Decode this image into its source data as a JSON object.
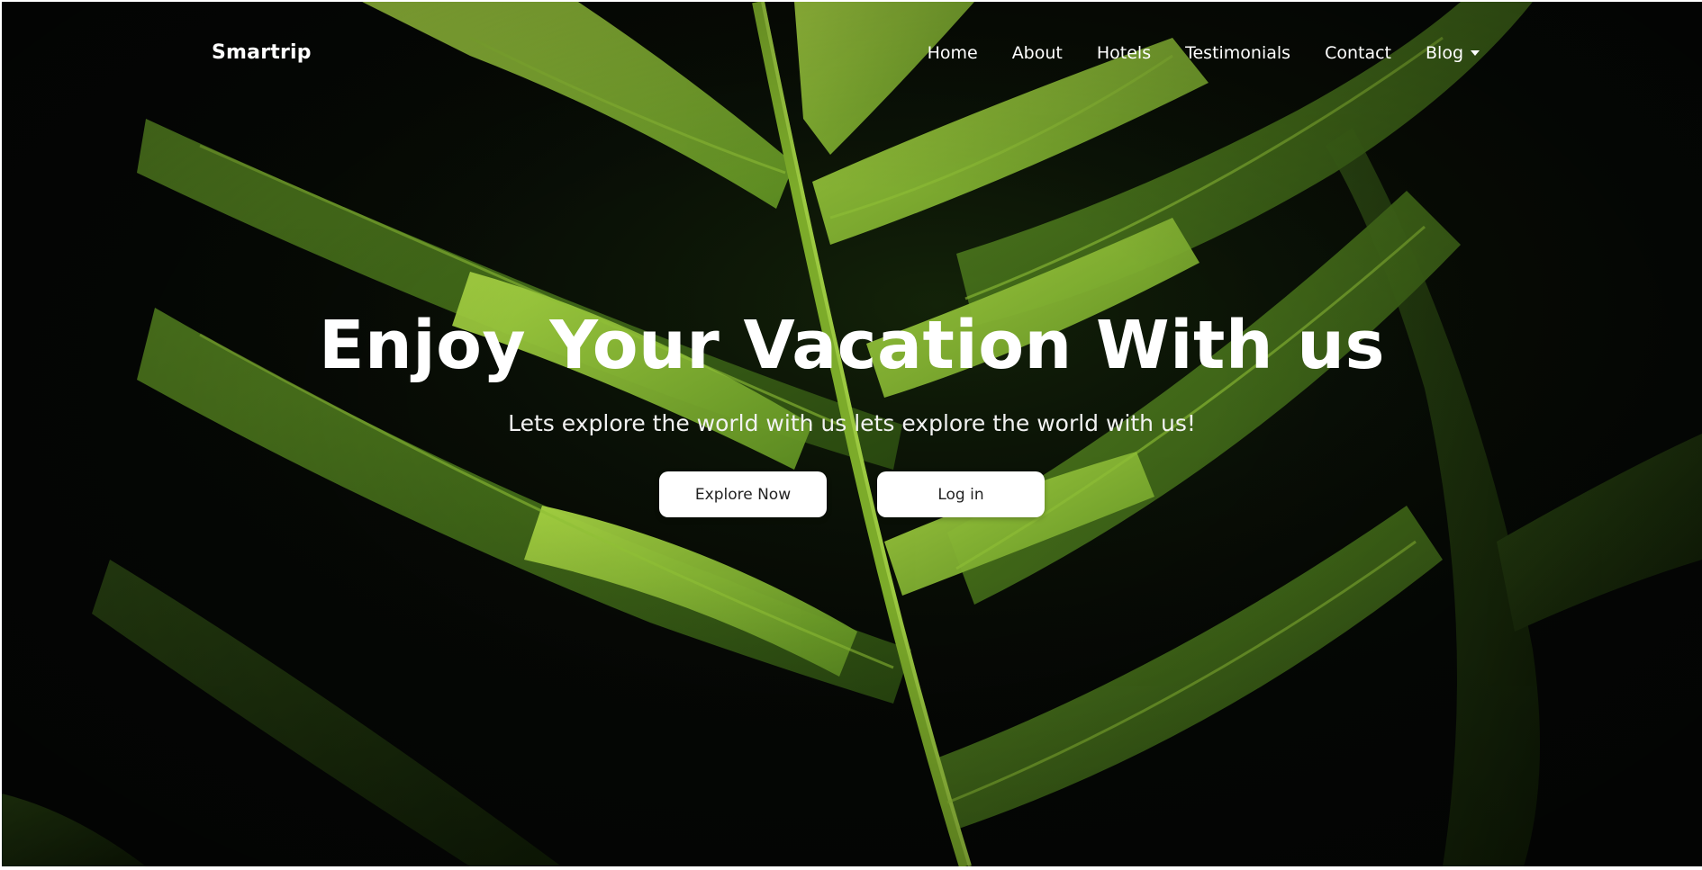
{
  "navbar": {
    "brand": "Smartrip",
    "links": [
      {
        "label": "Home"
      },
      {
        "label": "About"
      },
      {
        "label": "Hotels"
      },
      {
        "label": "Testimonials"
      },
      {
        "label": "Contact"
      },
      {
        "label": "Blog",
        "has_dropdown": true
      }
    ]
  },
  "hero": {
    "title": "Enjoy Your Vacation With us",
    "subtitle": "Lets explore the world with us lets explore the world with us!",
    "primary_button": "Explore Now",
    "secondary_button": "Log in",
    "background_image": "dark green fern leaves photograph"
  },
  "colors": {
    "text": "#ffffff",
    "button_bg": "#ffffff",
    "button_text": "#222222",
    "background": "#040504",
    "leaf_light": "#9bc93a",
    "leaf_mid": "#4f7d1c",
    "leaf_dark": "#1c330b"
  },
  "icons": {
    "blog_dropdown": "caret-down-icon"
  }
}
